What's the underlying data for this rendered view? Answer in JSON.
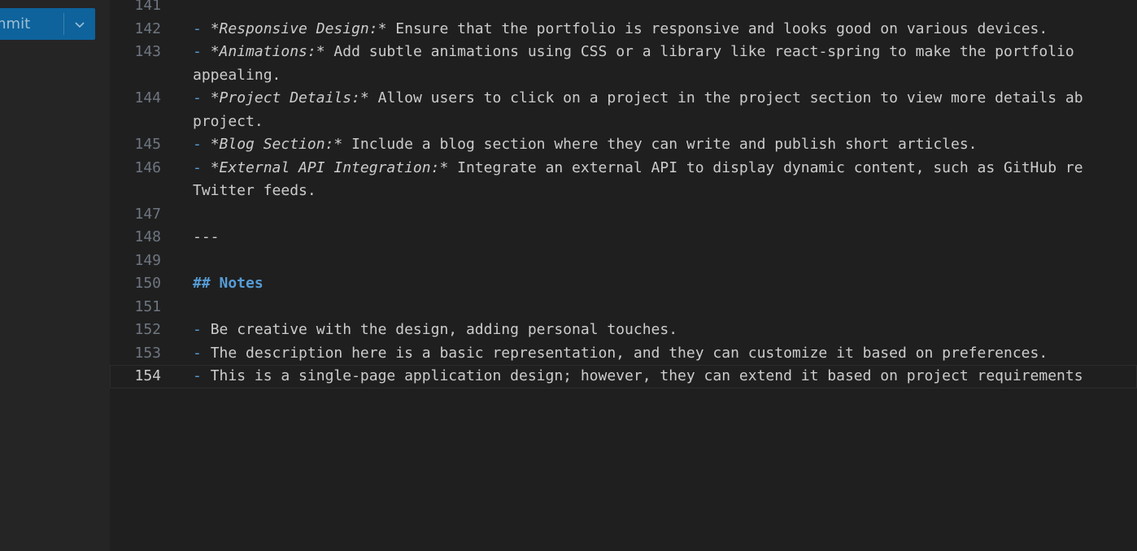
{
  "sidebar": {
    "commit_label": "mmit"
  },
  "editor": {
    "lines": [
      {
        "n": "141",
        "parts": []
      },
      {
        "n": "142",
        "parts": [
          {
            "t": "- ",
            "c": "bullet"
          },
          {
            "t": "*Responsive Design:*",
            "c": "em"
          },
          {
            "t": " Ensure that the portfolio is responsive and looks good on various devices."
          }
        ]
      },
      {
        "n": "143",
        "parts": [
          {
            "t": "- ",
            "c": "bullet"
          },
          {
            "t": "*Animations:*",
            "c": "em"
          },
          {
            "t": " Add subtle animations using CSS or a library like react-spring to make the portfolio"
          }
        ]
      },
      {
        "n": "",
        "parts": [
          {
            "t": "appealing."
          }
        ]
      },
      {
        "n": "144",
        "parts": [
          {
            "t": "- ",
            "c": "bullet"
          },
          {
            "t": "*Project Details:*",
            "c": "em"
          },
          {
            "t": " Allow users to click on a project in the project section to view more details ab"
          }
        ]
      },
      {
        "n": "",
        "parts": [
          {
            "t": "project."
          }
        ]
      },
      {
        "n": "145",
        "parts": [
          {
            "t": "- ",
            "c": "bullet"
          },
          {
            "t": "*Blog Section:*",
            "c": "em"
          },
          {
            "t": " Include a blog section where they can write and publish short articles."
          }
        ]
      },
      {
        "n": "146",
        "parts": [
          {
            "t": "- ",
            "c": "bullet"
          },
          {
            "t": "*External API Integration:*",
            "c": "em"
          },
          {
            "t": " Integrate an external API to display dynamic content, such as GitHub re"
          }
        ]
      },
      {
        "n": "",
        "parts": [
          {
            "t": "Twitter feeds."
          }
        ]
      },
      {
        "n": "147",
        "parts": []
      },
      {
        "n": "148",
        "parts": [
          {
            "t": "---"
          }
        ]
      },
      {
        "n": "149",
        "parts": []
      },
      {
        "n": "150",
        "parts": [
          {
            "t": "## Notes",
            "c": "heading"
          }
        ]
      },
      {
        "n": "151",
        "parts": []
      },
      {
        "n": "152",
        "parts": [
          {
            "t": "- ",
            "c": "bullet"
          },
          {
            "t": "Be creative with the design, adding personal touches."
          }
        ]
      },
      {
        "n": "153",
        "parts": [
          {
            "t": "- ",
            "c": "bullet"
          },
          {
            "t": "The description here is a basic representation, and they can customize it based on preferences."
          }
        ]
      },
      {
        "n": "154",
        "active": true,
        "parts": [
          {
            "t": "- ",
            "c": "bullet"
          },
          {
            "t": "This is a single-page application design; however, they can extend it based on project requirements"
          }
        ]
      }
    ]
  },
  "icons": {
    "dropdown": "chevron-down-icon"
  },
  "colors": {
    "background": "#1f1f1f",
    "sidebar": "#252526",
    "accent_button": "#0e639c",
    "markdown_punctuation": "#569cd6",
    "text": "#cccccc",
    "line_number": "#6e7681"
  }
}
